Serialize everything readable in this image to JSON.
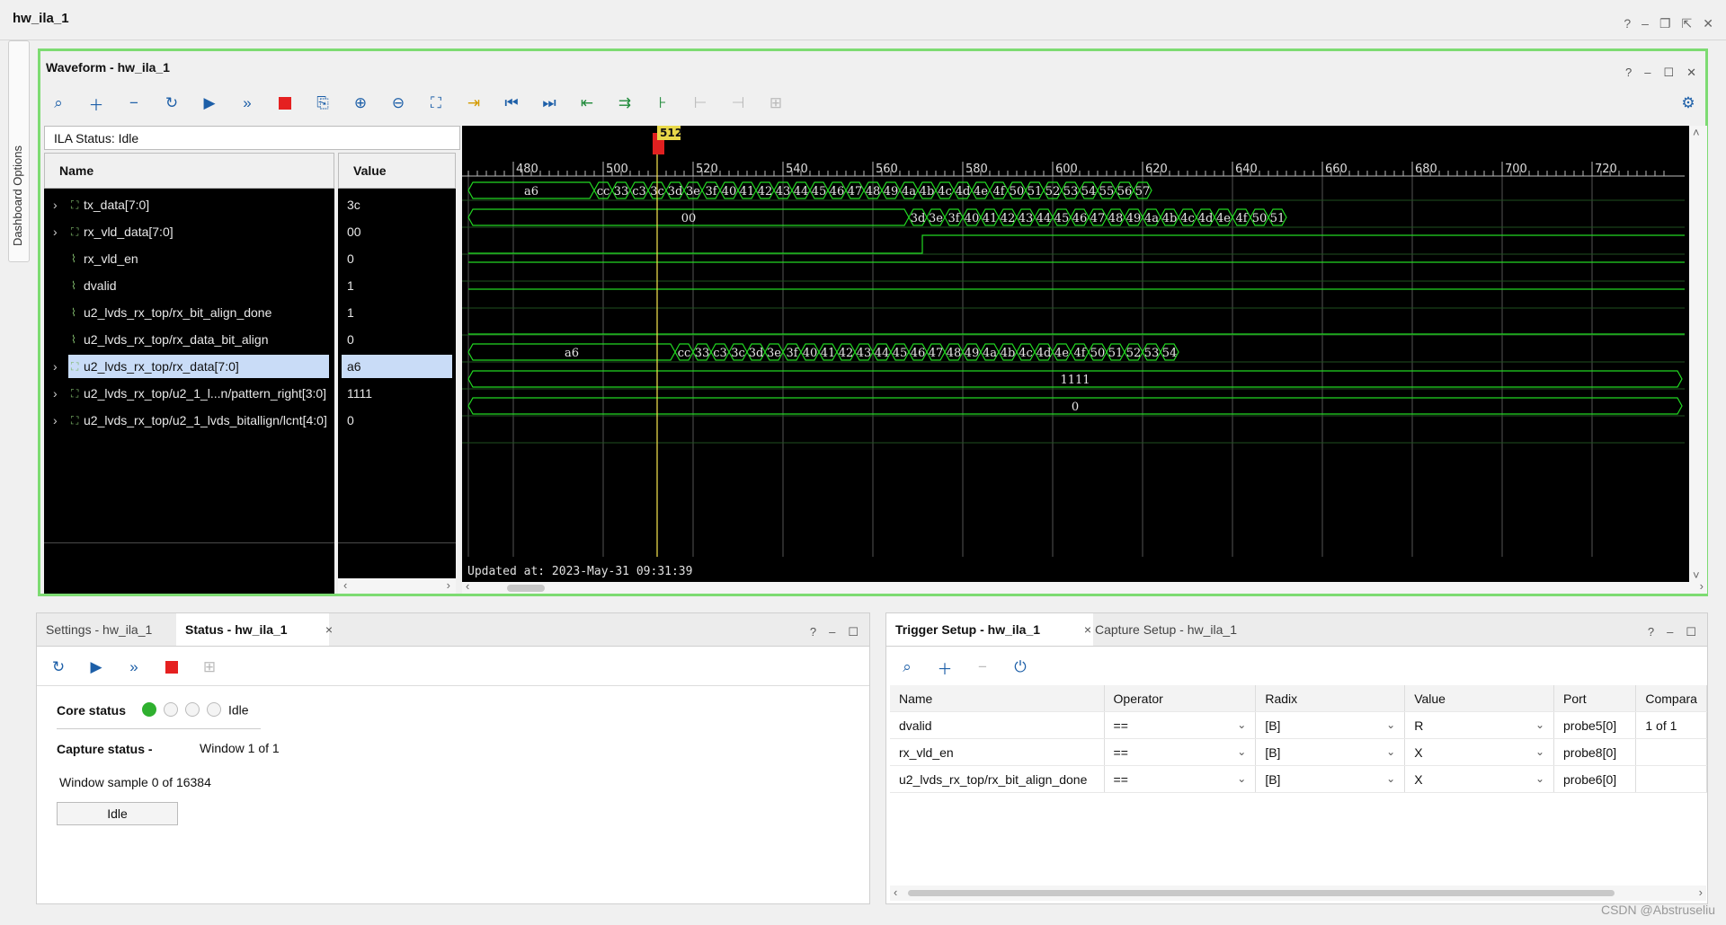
{
  "app": {
    "title": "hw_ila_1",
    "watermark": "CSDN @Abstruseliu"
  },
  "sidebar": {
    "dashboard_label": "Dashboard Options"
  },
  "waveform": {
    "title": "Waveform - hw_ila_1",
    "ila_status": "ILA Status:  Idle",
    "name_header": "Name",
    "value_header": "Value",
    "marker_label": "512",
    "updated": "Updated at: 2023-May-31 09:31:39",
    "signals": [
      {
        "name": "tx_data[7:0]",
        "value": "3c",
        "bus": true
      },
      {
        "name": "rx_vld_data[7:0]",
        "value": "00",
        "bus": true
      },
      {
        "name": "rx_vld_en",
        "value": "0",
        "bus": false
      },
      {
        "name": "dvalid",
        "value": "1",
        "bus": false
      },
      {
        "name": "u2_lvds_rx_top/rx_bit_align_done",
        "value": "1",
        "bus": false
      },
      {
        "name": "u2_lvds_rx_top/rx_data_bit_align",
        "value": "0",
        "bus": false
      },
      {
        "name": "u2_lvds_rx_top/rx_data[7:0]",
        "value": "a6",
        "bus": true
      },
      {
        "name": "u2_lvds_rx_top/u2_1_l...n/pattern_right[3:0]",
        "value": "1111",
        "bus": true
      },
      {
        "name": "u2_lvds_rx_top/u2_1_lvds_bitallign/lcnt[4:0]",
        "value": "0",
        "bus": true
      }
    ],
    "ruler_labels": [
      "480",
      "500",
      "520",
      "540",
      "560",
      "580",
      "600",
      "620",
      "640",
      "660",
      "680",
      "700",
      "720"
    ],
    "tx_values": [
      "a6",
      "cc",
      "33",
      "c3",
      "3c",
      "3d",
      "3e",
      "3f",
      "40",
      "41",
      "42",
      "43",
      "44",
      "45",
      "46",
      "47",
      "48",
      "49",
      "4a",
      "4b",
      "4c",
      "4d",
      "4e",
      "4f",
      "50",
      "51",
      "52",
      "53",
      "54",
      "55",
      "56",
      "57"
    ],
    "rxvld_values": [
      "00",
      "3d",
      "3e",
      "3f",
      "40",
      "41",
      "42",
      "43",
      "44",
      "45",
      "46",
      "47",
      "48",
      "49",
      "4a",
      "4b",
      "4c",
      "4d",
      "4e",
      "4f",
      "50",
      "51"
    ],
    "rxdata_values": [
      "a6",
      "cc",
      "33",
      "c3",
      "3c",
      "3d",
      "3e",
      "3f",
      "40",
      "41",
      "42",
      "43",
      "44",
      "45",
      "46",
      "47",
      "48",
      "49",
      "4a",
      "4b",
      "4c",
      "4d",
      "4e",
      "4f",
      "50",
      "51",
      "52",
      "53",
      "54"
    ],
    "pattern_value": "1111",
    "lcnt_value": "0"
  },
  "status_panel": {
    "tab_settings": "Settings - hw_ila_1",
    "tab_status": "Status - hw_ila_1",
    "core_status_label": "Core status",
    "core_status_value": "Idle",
    "capture_status_label": "Capture status -",
    "capture_status_value": "Window 1 of 1",
    "window_sample": "Window sample 0 of 16384",
    "idle_button": "Idle"
  },
  "trigger_panel": {
    "tab_trigger": "Trigger Setup - hw_ila_1",
    "tab_capture": "Capture Setup - hw_ila_1",
    "columns": [
      "Name",
      "Operator",
      "Radix",
      "Value",
      "Port",
      "Compara"
    ],
    "rows": [
      {
        "name": "dvalid",
        "operator": "==",
        "radix": "[B]",
        "value": "R",
        "port": "probe5[0]",
        "compare": "1 of 1"
      },
      {
        "name": "rx_vld_en",
        "operator": "==",
        "radix": "[B]",
        "value": "X",
        "port": "probe8[0]",
        "compare": ""
      },
      {
        "name": "u2_lvds_rx_top/rx_bit_align_done",
        "operator": "==",
        "radix": "[B]",
        "value": "X",
        "port": "probe6[0]",
        "compare": ""
      }
    ]
  }
}
